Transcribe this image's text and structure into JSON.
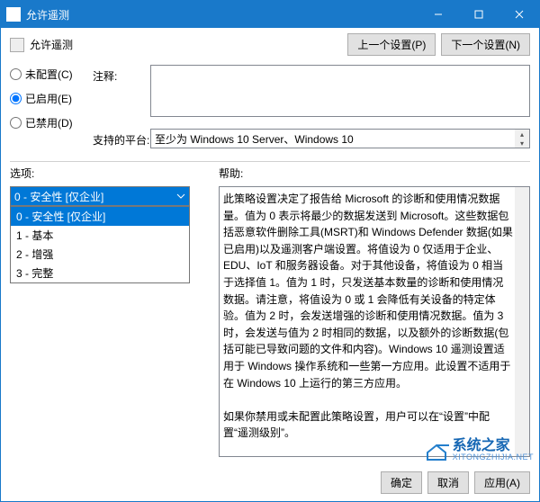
{
  "window": {
    "title": "允许遥测",
    "subtitle": "允许遥测"
  },
  "nav": {
    "prev": "上一个设置(P)",
    "next": "下一个设置(N)"
  },
  "radios": {
    "not_configured": "未配置(C)",
    "enabled": "已启用(E)",
    "disabled": "已禁用(D)"
  },
  "fields": {
    "comment_label": "注释:",
    "comment_value": "",
    "platform_label": "支持的平台:",
    "platform_value": "至少为 Windows 10 Server、Windows 10"
  },
  "labels": {
    "options": "选项:",
    "help": "帮助:"
  },
  "dropdown": {
    "selected": "0 - 安全性 [仅企业]",
    "options": [
      "0 - 安全性 [仅企业]",
      "1 - 基本",
      "2 - 增强",
      "3 - 完整"
    ]
  },
  "help": {
    "p1": "此策略设置决定了报告给 Microsoft 的诊断和使用情况数据量。值为 0 表示将最少的数据发送到 Microsoft。这些数据包括恶意软件删除工具(MSRT)和 Windows Defender 数据(如果已启用)以及遥测客户端设置。将值设为 0 仅适用于企业、EDU、IoT 和服务器设备。对于其他设备，将值设为 0 相当于选择值 1。值为 1 时，只发送基本数量的诊断和使用情况数据。请注意，将值设为 0 或 1 会降低有关设备的特定体验。值为 2 时，会发送增强的诊断和使用情况数据。值为 3 时，会发送与值为 2 时相同的数据，以及额外的诊断数据(包括可能已导致问题的文件和内容)。Windows 10 遥测设置适用于 Windows 操作系统和一些第一方应用。此设置不适用于在 Windows 10 上运行的第三方应用。",
    "p2": "如果你禁用或未配置此策略设置，用户可以在“设置”中配置“遥测级别”。"
  },
  "buttons": {
    "ok": "确定",
    "cancel": "取消",
    "apply": "应用(A)"
  },
  "watermark": {
    "cn": "系统之家",
    "en": "XITONGZHIJIA.NET"
  }
}
